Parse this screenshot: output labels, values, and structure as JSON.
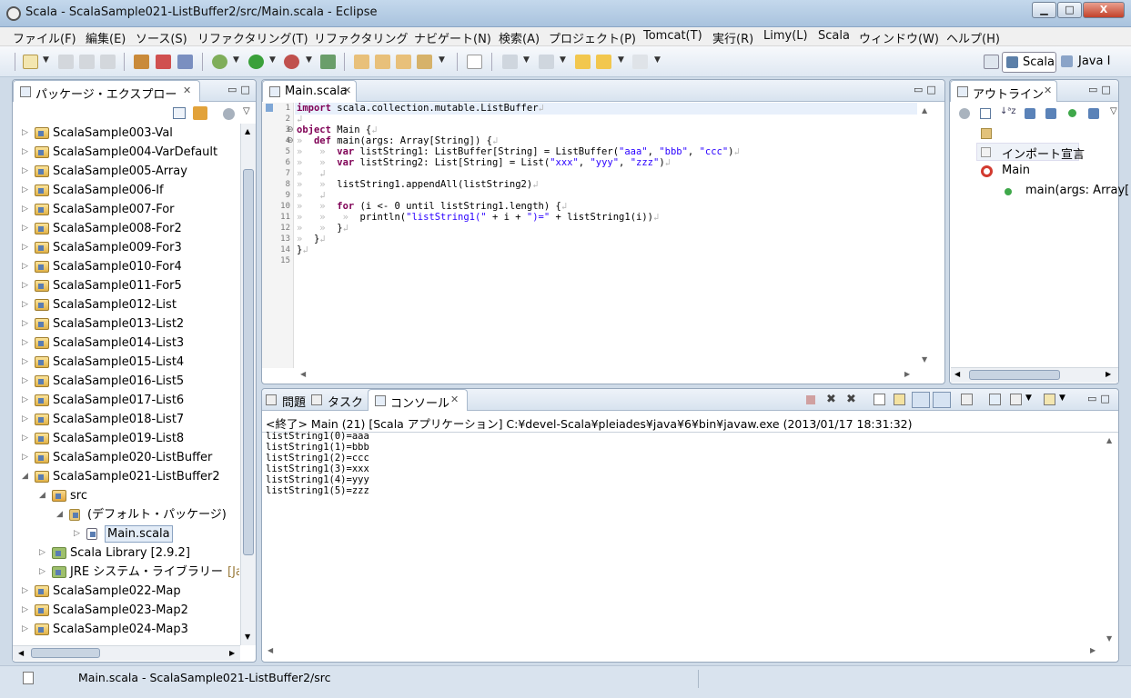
{
  "window": {
    "title": "Scala - ScalaSample021-ListBuffer2/src/Main.scala - Eclipse",
    "min": "▁",
    "max": "□",
    "close": "X"
  },
  "menu": [
    "ファイル(F)",
    "編集(E)",
    "ソース(S)",
    "リファクタリング(T)",
    "リファクタリング",
    "ナビゲート(N)",
    "検索(A)",
    "プロジェクト(P)",
    "Tomcat(T)",
    "実行(R)",
    "Limy(L)",
    "Scala",
    "ウィンドウ(W)",
    "ヘルプ(H)"
  ],
  "perspectives": {
    "scala": "Scala",
    "java": "Java I"
  },
  "explorer": {
    "title": "パッケージ・エクスプロー",
    "projects": [
      "ScalaSample003-Val",
      "ScalaSample004-VarDefault",
      "ScalaSample005-Array",
      "ScalaSample006-If",
      "ScalaSample007-For",
      "ScalaSample008-For2",
      "ScalaSample009-For3",
      "ScalaSample010-For4",
      "ScalaSample011-For5",
      "ScalaSample012-List",
      "ScalaSample013-List2",
      "ScalaSample014-List3",
      "ScalaSample015-List4",
      "ScalaSample016-List5",
      "ScalaSample017-List6",
      "ScalaSample018-List7",
      "ScalaSample019-List8",
      "ScalaSample020-ListBuffer",
      "ScalaSample021-ListBuffer2"
    ],
    "src": "src",
    "default_package": "(デフォルト・パッケージ)",
    "main_file": "Main.scala",
    "scala_library": "Scala Library [2.9.2]",
    "jre": "JRE システム・ライブラリー",
    "jre_suffix": "[Java",
    "more_projects": [
      "ScalaSample022-Map",
      "ScalaSample023-Map2",
      "ScalaSample024-Map3"
    ]
  },
  "editor": {
    "tab": "Main.scala",
    "line_numbers": [
      "1",
      "2",
      "3",
      "4",
      "5",
      "6",
      "7",
      "8",
      "9",
      "10",
      "11",
      "12",
      "13",
      "14",
      "15"
    ]
  },
  "outline": {
    "title": "アウトライン",
    "imports": "インポート宣言",
    "object": "Main",
    "method": "main(args: Array["
  },
  "console": {
    "tabs": {
      "problems": "問題",
      "tasks": "タスク",
      "console": "コンソール"
    },
    "header": "<終了> Main (21) [Scala アプリケーション] C:¥devel-Scala¥pleiades¥java¥6¥bin¥javaw.exe (2013/01/17 18:31:32)",
    "output": [
      "listString1(0)=aaa",
      "listString1(1)=bbb",
      "listString1(2)=ccc",
      "listString1(3)=xxx",
      "listString1(4)=yyy",
      "listString1(5)=zzz"
    ]
  },
  "status": {
    "path": "Main.scala - ScalaSample021-ListBuffer2/src"
  }
}
